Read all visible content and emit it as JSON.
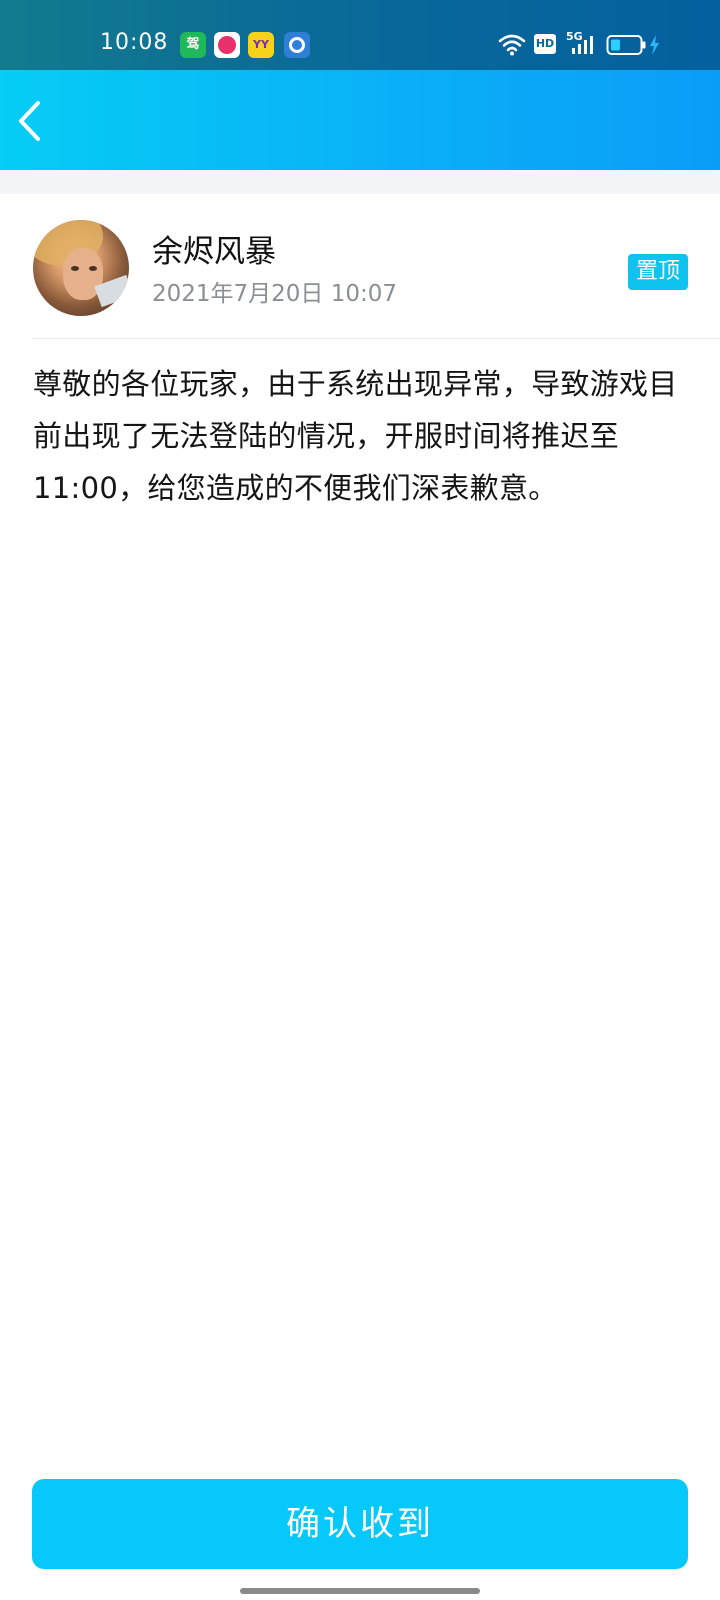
{
  "status_bar": {
    "time": "10:08",
    "notification_icons": [
      {
        "name": "driving-app-icon",
        "glyph": "驾"
      },
      {
        "name": "pink-app-icon",
        "glyph": ""
      },
      {
        "name": "yy-app-icon",
        "glyph": "YY"
      },
      {
        "name": "blue-app-icon",
        "glyph": ""
      }
    ],
    "network": "5G",
    "hd_label": "HD"
  },
  "header": {
    "back_icon": "chevron-left-icon"
  },
  "author": {
    "name": "余烬风暴",
    "date": "2021年7月20日 10:07",
    "pin_label": "置顶"
  },
  "message": {
    "body": "尊敬的各位玩家，由于系统出现异常，导致游戏目前出现了无法登陆的情况，开服时间将推迟至11:00，给您造成的不便我们深表歉意。"
  },
  "footer": {
    "confirm_label": "确认收到"
  },
  "colors": {
    "accent": "#06c8fb",
    "header_start": "#05cdf5",
    "header_end": "#0a9df8",
    "pin_badge": "#10c3ef"
  }
}
